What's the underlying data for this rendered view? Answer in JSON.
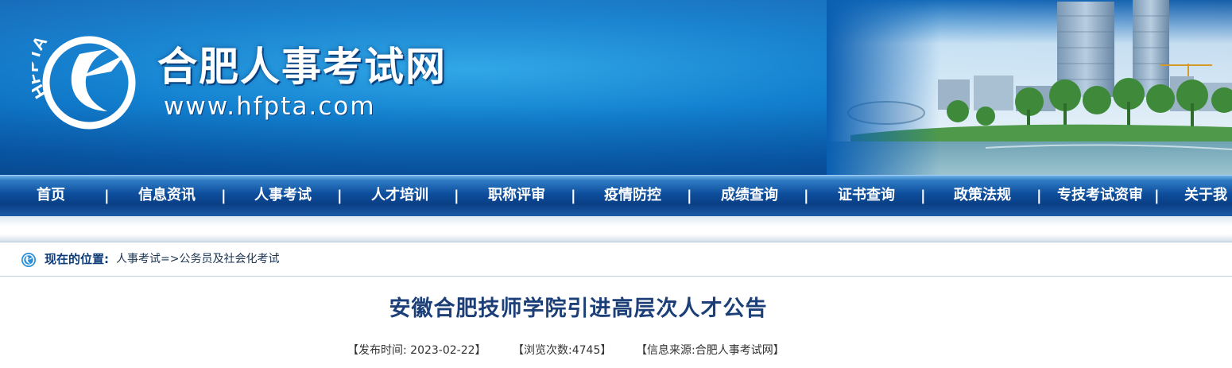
{
  "banner": {
    "logo_text": "HFPTA",
    "site_title": "合肥人事考试网",
    "site_url": "www.hfpta.com"
  },
  "nav": {
    "items": [
      {
        "label": "首页"
      },
      {
        "label": "信息资讯"
      },
      {
        "label": "人事考试"
      },
      {
        "label": "人才培训"
      },
      {
        "label": "职称评审"
      },
      {
        "label": "疫情防控"
      },
      {
        "label": "成绩查询"
      },
      {
        "label": "证书查询"
      },
      {
        "label": "政策法规"
      },
      {
        "label": "专技考试资审"
      },
      {
        "label": "关于我"
      }
    ],
    "separator": "|"
  },
  "breadcrumb": {
    "label": "现在的位置",
    "colon": ":",
    "path": "人事考试=>公务员及社会化考试"
  },
  "article": {
    "title": "安徽合肥技师学院引进高层次人才公告",
    "publish_time": "【发布时间: 2023-02-22】",
    "views": "【浏览次数:4745】",
    "source": "【信息来源:合肥人事考试网】"
  },
  "colors": {
    "nav_text": "#ffffff",
    "title_text": "#1c3f78",
    "breadcrumb_label": "#0d3c78"
  }
}
